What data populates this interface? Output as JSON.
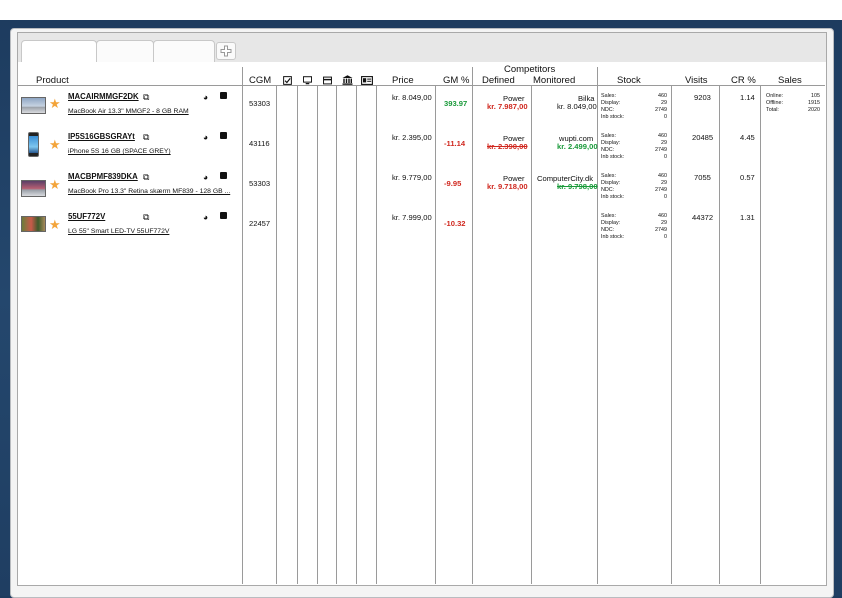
{
  "tabs": [
    "",
    "",
    ""
  ],
  "columns": {
    "product": "Product",
    "cgm": "CGM",
    "price": "Price",
    "gm": "GM %",
    "competitors": "Competitors",
    "defined": "Defined",
    "monitored": "Monitored",
    "stock": "Stock",
    "visits": "Visits",
    "cr": "CR %",
    "sales": "Sales"
  },
  "header_icons": [
    "checkbox-icon",
    "monitor-icon",
    "card-icon",
    "bank-icon",
    "id-card-icon"
  ],
  "rows": [
    {
      "sku": "MACAIRMMGF2DK",
      "name": "MacBook Air 13.3\" MMGF2 - 8 GB RAM",
      "cgm": "53303",
      "price": "kr. 8.049,00",
      "gm": "393.97",
      "gm_color": "green",
      "defined_name": "Power",
      "defined_price": "kr. 7.987,00",
      "defined_style": "red",
      "monitored_name": "Bilka",
      "monitored_price": "kr. 8.049,00",
      "monitored_style": "plain",
      "stock": {
        "sales": "460",
        "display": "29",
        "ndc": "2749",
        "inb": "0"
      },
      "visits": "9203",
      "cr": "1.14",
      "sales": {
        "online": "105",
        "offline": "1915",
        "total": "2020"
      },
      "thumb": "laptop"
    },
    {
      "sku": "IP5S16GBSGRAYt",
      "name": "iPhone 5S 16 GB (SPACE GREY)",
      "cgm": "43116",
      "price": "kr. 2.395,00",
      "gm": "-11.14",
      "gm_color": "red",
      "defined_name": "Power",
      "defined_price": "kr. 2.390,00",
      "defined_style": "red-strike",
      "monitored_name": "wupti.com",
      "monitored_price": "kr. 2.499,00",
      "monitored_style": "green",
      "stock": {
        "sales": "460",
        "display": "29",
        "ndc": "2749",
        "inb": "0"
      },
      "visits": "20485",
      "cr": "4.45",
      "thumb": "phone"
    },
    {
      "sku": "MACBPMF839DKA",
      "name": "MacBook Pro 13.3\" Retina skærm MF839 - 128 GB ...",
      "cgm": "53303",
      "price": "kr. 9.779,00",
      "gm": "-9.95",
      "gm_color": "red",
      "defined_name": "Power",
      "defined_price": "kr. 9.718,00",
      "defined_style": "red",
      "monitored_name": "ComputerCity.dk",
      "monitored_price": "kr. 9.798,00",
      "monitored_style": "green-strike",
      "stock": {
        "sales": "460",
        "display": "29",
        "ndc": "2749",
        "inb": "0"
      },
      "visits": "7055",
      "cr": "0.57",
      "thumb": "laptop"
    },
    {
      "sku": "55UF772V",
      "name": "LG 55\" Smart LED-TV 55UF772V",
      "cgm": "22457",
      "price": "kr. 7.999,00",
      "gm": "-10.32",
      "gm_color": "red",
      "stock": {
        "sales": "460",
        "display": "29",
        "ndc": "2749",
        "inb": "0"
      },
      "visits": "44372",
      "cr": "1.31",
      "thumb": "tv"
    }
  ],
  "stock_labels": {
    "sales": "Sales:",
    "display": "Display:",
    "ndc": "NDC:",
    "inb": "Inb stock:"
  },
  "sales_labels": {
    "online": "Online:",
    "offline": "Offline:",
    "total": "Total:"
  },
  "colors": {
    "green": "#1a9a3a",
    "red": "#d0281f",
    "star": "#f3a43a",
    "background": "#1d3b5e"
  }
}
